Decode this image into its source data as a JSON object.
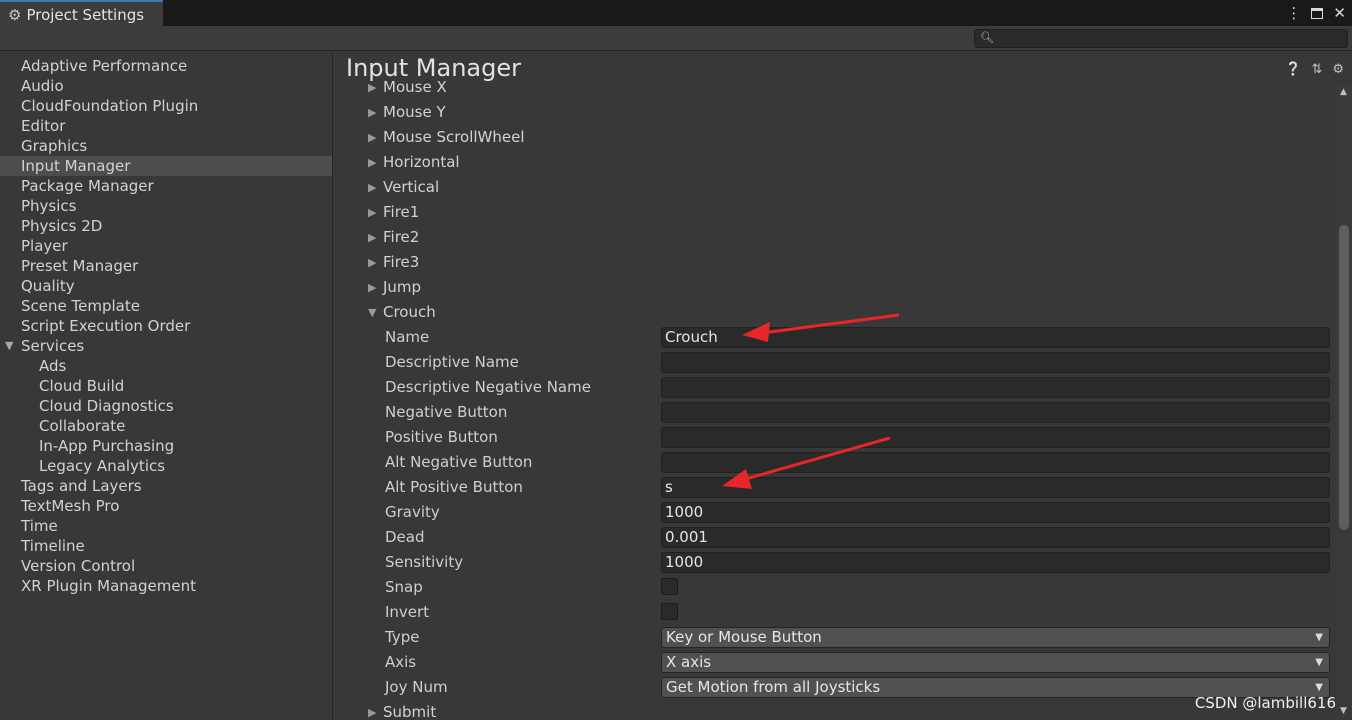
{
  "window": {
    "tab_title": "Project Settings",
    "tab_icon": "gear-icon",
    "controls": {
      "menu": "⋮",
      "maximize": "maximize-icon",
      "close": "✕"
    }
  },
  "toolbar": {
    "search_placeholder": ""
  },
  "sidebar": {
    "items": [
      {
        "label": "Adaptive Performance"
      },
      {
        "label": "Audio"
      },
      {
        "label": "CloudFoundation Plugin"
      },
      {
        "label": "Editor"
      },
      {
        "label": "Graphics"
      },
      {
        "label": "Input Manager",
        "selected": true
      },
      {
        "label": "Package Manager"
      },
      {
        "label": "Physics"
      },
      {
        "label": "Physics 2D"
      },
      {
        "label": "Player"
      },
      {
        "label": "Preset Manager"
      },
      {
        "label": "Quality"
      },
      {
        "label": "Scene Template"
      },
      {
        "label": "Script Execution Order"
      },
      {
        "label": "Services",
        "expanded": true
      },
      {
        "label": "Ads",
        "sub": true
      },
      {
        "label": "Cloud Build",
        "sub": true
      },
      {
        "label": "Cloud Diagnostics",
        "sub": true
      },
      {
        "label": "Collaborate",
        "sub": true
      },
      {
        "label": "In-App Purchasing",
        "sub": true
      },
      {
        "label": "Legacy Analytics",
        "sub": true
      },
      {
        "label": "Tags and Layers"
      },
      {
        "label": "TextMesh Pro"
      },
      {
        "label": "Time"
      },
      {
        "label": "Timeline"
      },
      {
        "label": "Version Control"
      },
      {
        "label": "XR Plugin Management"
      }
    ]
  },
  "main": {
    "title": "Input Manager",
    "title_icons": [
      "help-icon",
      "preset-icon",
      "settings-icon"
    ],
    "axes_before": [
      "Mouse X",
      "Mouse Y",
      "Mouse ScrollWheel",
      "Horizontal",
      "Vertical",
      "Fire1",
      "Fire2",
      "Fire3",
      "Jump"
    ],
    "expanded_axis": "Crouch",
    "properties": {
      "name": {
        "label": "Name",
        "value": "Crouch"
      },
      "descriptive_name": {
        "label": "Descriptive Name",
        "value": ""
      },
      "descriptive_negative_name": {
        "label": "Descriptive Negative Name",
        "value": ""
      },
      "negative_button": {
        "label": "Negative Button",
        "value": ""
      },
      "positive_button": {
        "label": "Positive Button",
        "value": ""
      },
      "alt_negative_button": {
        "label": "Alt Negative Button",
        "value": ""
      },
      "alt_positive_button": {
        "label": "Alt Positive Button",
        "value": "s"
      },
      "gravity": {
        "label": "Gravity",
        "value": "1000"
      },
      "dead": {
        "label": "Dead",
        "value": "0.001"
      },
      "sensitivity": {
        "label": "Sensitivity",
        "value": "1000"
      },
      "snap": {
        "label": "Snap",
        "checked": false
      },
      "invert": {
        "label": "Invert",
        "checked": false
      },
      "type": {
        "label": "Type",
        "value": "Key or Mouse Button"
      },
      "axis": {
        "label": "Axis",
        "value": "X axis"
      },
      "joy_num": {
        "label": "Joy Num",
        "value": "Get Motion from all Joysticks"
      }
    },
    "axes_after": [
      "Submit"
    ]
  },
  "annotations": {
    "arrow_color": "#e8262a"
  },
  "watermark": "CSDN @lambill616"
}
